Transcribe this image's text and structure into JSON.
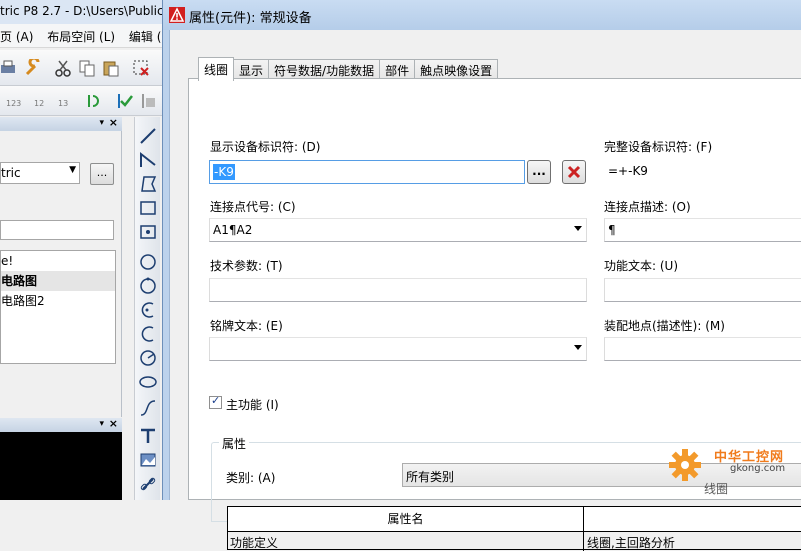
{
  "app": {
    "title": "tric P8 2.7 - D:\\Users\\Public",
    "menu": [
      "页 (A)",
      "布局空间 (L)",
      "编辑 (E)"
    ],
    "panel": {
      "select_value": "tric",
      "more_label": "...",
      "list_items": [
        "e!",
        "电路图",
        "电路图2"
      ]
    }
  },
  "dialog": {
    "title": "属性(元件): 常规设备",
    "tabs": [
      "线圈",
      "显示",
      "符号数据/功能数据",
      "部件",
      "触点映像设置"
    ],
    "fields": {
      "display_id_label": "显示设备标识符: (D)",
      "display_id_value": "-K9",
      "browse_label": "...",
      "full_id_label": "完整设备标识符: (F)",
      "full_id_value": "=+-K9",
      "conn_code_label": "连接点代号: (C)",
      "conn_code_value": "A1¶A2",
      "conn_desc_label": "连接点描述: (O)",
      "conn_desc_value": "¶",
      "tech_params_label": "技术参数: (T)",
      "func_text_label": "功能文本: (U)",
      "nameplate_label": "铭牌文本: (E)",
      "location_label": "装配地点(描述性): (M)",
      "main_function_label": "主功能 (I)"
    },
    "properties": {
      "group_label": "属性",
      "category_label": "类别: (A)",
      "category_value": "所有类别",
      "col_name": "属性名",
      "row_name": "功能定义",
      "row_value": "线圈,主回路分析"
    }
  },
  "watermark": {
    "brand": "中华工控网",
    "url": "gkong.com",
    "sub": "线圈"
  },
  "colors": {
    "selection": "#3399ff",
    "dialog_frame": "#bcd2ec",
    "delete_red": "#cc2222",
    "watermark_orange": "#f07b1c"
  },
  "icons": {
    "dialog": "eplan-warning-icon",
    "delete": "red-x-icon",
    "checkbox": "checked"
  }
}
